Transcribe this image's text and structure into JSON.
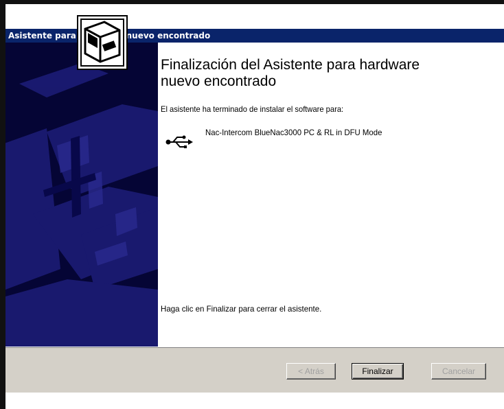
{
  "window": {
    "title": "Asistente para hardware nuevo encontrado"
  },
  "main": {
    "heading": "Finalización del Asistente para hardware nuevo encontrado",
    "intro": "El asistente ha terminado de instalar el software para:",
    "device_name": "Nac-Intercom BlueNac3000 PC & RL in DFU Mode",
    "finish_hint": "Haga clic en Finalizar para cerrar el asistente."
  },
  "buttons": {
    "back": "< Atrás",
    "finish": "Finalizar",
    "cancel": "Cancelar"
  },
  "colors": {
    "titlebar": "#0a246a",
    "side_panel": "#050535",
    "footer": "#d4d0c8"
  },
  "icons": [
    "hardware-wizard-icon",
    "usb-icon"
  ]
}
